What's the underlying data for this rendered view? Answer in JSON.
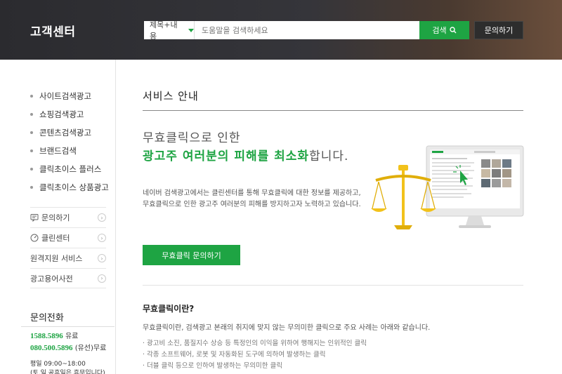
{
  "header": {
    "brand": "고객센터",
    "search": {
      "select_value": "제목+내용",
      "placeholder": "도움말을 검색하세요",
      "button_label": "검색"
    },
    "inquiry_label": "문의하기"
  },
  "sidebar": {
    "menu": [
      {
        "label": "사이트검색광고"
      },
      {
        "label": "쇼핑검색광고"
      },
      {
        "label": "콘텐츠검색광고"
      },
      {
        "label": "브랜드검색"
      },
      {
        "label": "클릭초이스 플러스"
      },
      {
        "label": "클릭초이스 상품광고"
      }
    ],
    "links": [
      {
        "label": "문의하기",
        "icon": "chat-icon"
      },
      {
        "label": "클린센터",
        "icon": "gauge-icon"
      },
      {
        "label": "원격지원 서비스",
        "icon": ""
      },
      {
        "label": "광고용어사전",
        "icon": ""
      }
    ],
    "phone": {
      "title": "문의전화",
      "line1_num": "1588.5896",
      "line1_note": "유료",
      "line2_num": "080.500.5896",
      "line2_note": "(유선)무료",
      "hours1": "평일 09:00~18:00",
      "hours2": "(토,일 공휴일은 휴무입니다)"
    }
  },
  "main": {
    "page_title": "서비스 안내",
    "hero_line1": "무효클릭으로 인한",
    "hero_highlight": "광고주 여러분의 피해를 최소화",
    "hero_suffix": "합니다.",
    "desc1": "네이버 검색광고에서는 클린센터를 통해 무효클릭에 대한 정보를 제공하고,",
    "desc2": "무효클릭으로 인한 광고주 여러분의 피해를 방지하고자 노력하고 있습니다.",
    "cta_label": "무효클릭 문의하기",
    "section_title": "무효클릭이란?",
    "section_desc": "무효클릭이란, 검색광고 본래의 취지에 맞지 않는 무의미한 클릭으로 주요 사례는 아래와 같습니다.",
    "bullets": [
      "· 광고비 소진, 품질지수 상승 등 특정인의 이익을 위하여 행해지는 인위적인 클릭",
      "· 각종 소프트웨어, 로봇 및 자동화된 도구에 의하여 발생하는 클릭",
      "· 더블 클릭 등으로 인하여 발생하는 무의미한 클릭"
    ]
  },
  "colors": {
    "accent": "#1ea443",
    "header_bg": "#2b2b2f"
  }
}
